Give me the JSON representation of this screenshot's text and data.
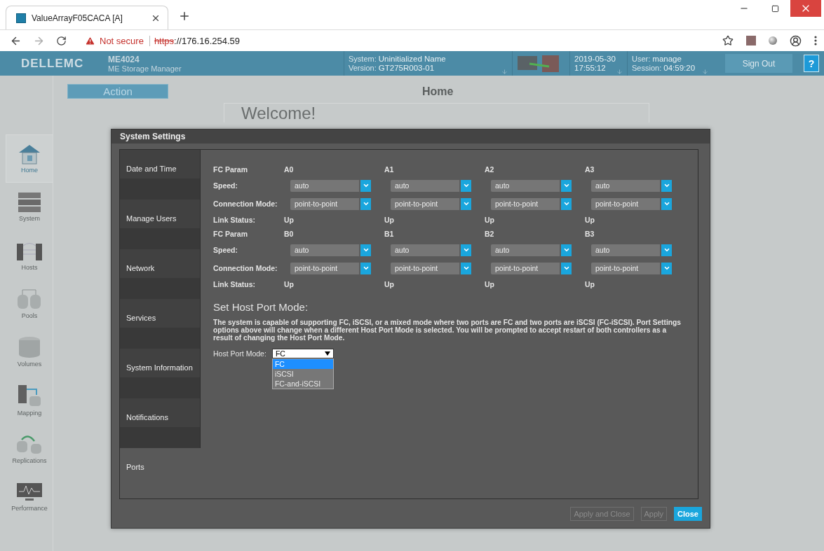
{
  "browser": {
    "tab_title": "ValueArrayF05CACA [A]",
    "warning": "Not secure",
    "scheme": "https",
    "address": "://176.16.254.59"
  },
  "header": {
    "logo": "DELLEMC",
    "product": "ME4024",
    "product_sub": "ME Storage Manager",
    "system_label": "System:",
    "system_value": "Uninitialized Name",
    "version_label": "Version:",
    "version_value": "GT275R003-01",
    "date": "2019-05-30",
    "time": "17:55:12",
    "user_label": "User:",
    "user_value": "manage",
    "session_label": "Session:",
    "session_value": "04:59:20",
    "sign_out": "Sign Out",
    "help": "?"
  },
  "nav": [
    {
      "label": "Home",
      "kind": "home",
      "selected": true
    },
    {
      "label": "System",
      "kind": "system",
      "selected": false
    },
    {
      "label": "Hosts",
      "kind": "hosts",
      "selected": false
    },
    {
      "label": "Pools",
      "kind": "pools",
      "selected": false
    },
    {
      "label": "Volumes",
      "kind": "volumes",
      "selected": false
    },
    {
      "label": "Mapping",
      "kind": "mapping",
      "selected": false
    },
    {
      "label": "Replications",
      "kind": "replications",
      "selected": false
    },
    {
      "label": "Performance",
      "kind": "performance",
      "selected": false
    }
  ],
  "page": {
    "action": "Action",
    "title": "Home",
    "welcome": "Welcome!"
  },
  "dialog": {
    "title": "System Settings",
    "tabs": [
      {
        "label": "Date and Time",
        "selected": false
      },
      {
        "label": "Manage Users",
        "selected": false
      },
      {
        "label": "Network",
        "selected": false
      },
      {
        "label": "Services",
        "selected": false
      },
      {
        "label": "System Information",
        "selected": false
      },
      {
        "label": "Notifications",
        "selected": false
      },
      {
        "label": "Ports",
        "selected": true
      }
    ],
    "port_groups": [
      {
        "param_label": "FC Param",
        "speed_label": "Speed:",
        "mode_label": "Connection Mode:",
        "status_label": "Link Status:",
        "ports": [
          {
            "name": "A0",
            "speed": "auto",
            "mode": "point-to-point",
            "status": "Up"
          },
          {
            "name": "A1",
            "speed": "auto",
            "mode": "point-to-point",
            "status": "Up"
          },
          {
            "name": "A2",
            "speed": "auto",
            "mode": "point-to-point",
            "status": "Up"
          },
          {
            "name": "A3",
            "speed": "auto",
            "mode": "point-to-point",
            "status": "Up"
          }
        ]
      },
      {
        "param_label": "FC Param",
        "speed_label": "Speed:",
        "mode_label": "Connection Mode:",
        "status_label": "Link Status:",
        "ports": [
          {
            "name": "B0",
            "speed": "auto",
            "mode": "point-to-point",
            "status": "Up"
          },
          {
            "name": "B1",
            "speed": "auto",
            "mode": "point-to-point",
            "status": "Up"
          },
          {
            "name": "B2",
            "speed": "auto",
            "mode": "point-to-point",
            "status": "Up"
          },
          {
            "name": "B3",
            "speed": "auto",
            "mode": "point-to-point",
            "status": "Up"
          }
        ]
      }
    ],
    "host_mode": {
      "heading": "Set Host Port Mode:",
      "description": "The system is capable of supporting FC, iSCSI, or a mixed mode where two ports are FC and two ports are iSCSI (FC-iSCSI). Port Settings options above will change when a different Host Port Mode is selected. You will be prompted to accept restart of both controllers as a result of changing the Host Port Mode.",
      "label": "Host Port Mode:",
      "value": "FC",
      "expanded": true,
      "options": [
        {
          "label": "FC",
          "selected": true
        },
        {
          "label": "iSCSI",
          "selected": false
        },
        {
          "label": "FC-and-iSCSI",
          "selected": false
        }
      ]
    },
    "buttons": [
      {
        "label": "Apply and Close",
        "disabled": true,
        "primary": false
      },
      {
        "label": "Apply",
        "disabled": true,
        "primary": false
      },
      {
        "label": "Close",
        "disabled": false,
        "primary": true
      }
    ]
  }
}
